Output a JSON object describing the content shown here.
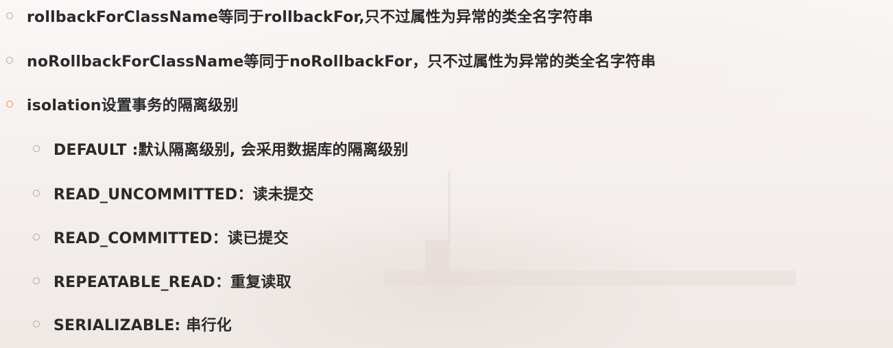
{
  "items": [
    {
      "text": "rollbackForClassName等同于rollbackFor,只不过属性为异常的类全名字符串"
    },
    {
      "text": "noRollbackForClassName等同于noRollbackFor，只不过属性为异常的类全名字符串"
    },
    {
      "text": "isolation设置事务的隔离级别"
    },
    {
      "text": "DEFAULT :默认隔离级别, 会采用数据库的隔离级别"
    },
    {
      "text": "READ_UNCOMMITTED：读未提交"
    },
    {
      "text": "READ_COMMITTED：读已提交"
    },
    {
      "text": "REPEATABLE_READ：重复读取"
    },
    {
      "text": "SERIALIZABLE: 串行化"
    }
  ],
  "colors": {
    "text": "#2a2a2a",
    "bullet_default": "#a8a8a8",
    "bullet_highlight": "#e7893a",
    "background": "#f4efed"
  }
}
